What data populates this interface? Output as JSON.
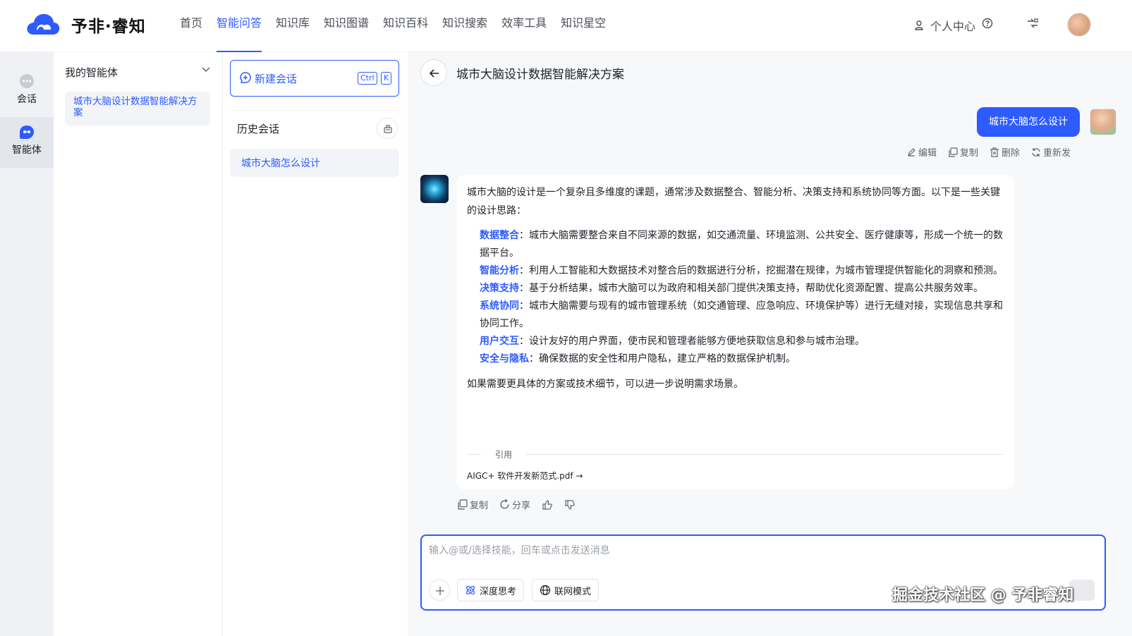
{
  "brand": {
    "name": "予非·睿知",
    "color": "#2e5bff"
  },
  "nav": {
    "items": [
      "首页",
      "智能问答",
      "知识库",
      "知识图谱",
      "知识百科",
      "知识搜索",
      "效率工具",
      "知识星空"
    ],
    "active_index": 1
  },
  "top_right": {
    "personal_center": "个人中心"
  },
  "rail": {
    "chat_label": "会话",
    "agent_label": "智能体"
  },
  "agents": {
    "header": "我的智能体",
    "items": [
      "城市大脑设计数据智能解决方案"
    ]
  },
  "history": {
    "new_chat_label": "新建会话",
    "shortcut_ctrl": "Ctrl",
    "shortcut_key": "K",
    "title": "历史会话",
    "items": [
      "城市大脑怎么设计"
    ]
  },
  "conversation": {
    "title": "城市大脑设计数据智能解决方案",
    "user_message": "城市大脑怎么设计",
    "user_actions": [
      "编辑",
      "复制",
      "删除",
      "重新发"
    ],
    "answer": {
      "intro": "城市大脑的设计是一个复杂且多维度的课题，通常涉及数据整合、智能分析、决策支持和系统协同等方面。以下是一些关键的设计思路：",
      "points": [
        {
          "label": "数据整合",
          "text": "：城市大脑需要整合来自不同来源的数据，如交通流量、环境监测、公共安全、医疗健康等，形成一个统一的数据平台。"
        },
        {
          "label": "智能分析",
          "text": "：利用人工智能和大数据技术对整合后的数据进行分析，挖掘潜在规律，为城市管理提供智能化的洞察和预测。"
        },
        {
          "label": "决策支持",
          "text": "：基于分析结果，城市大脑可以为政府和相关部门提供决策支持，帮助优化资源配置、提高公共服务效率。"
        },
        {
          "label": "系统协同",
          "text": "：城市大脑需要与现有的城市管理系统（如交通管理、应急响应、环境保护等）进行无缝对接，实现信息共享和协同工作。"
        },
        {
          "label": "用户交互",
          "text": "：设计友好的用户界面，使市民和管理者能够方便地获取信息和参与城市治理。"
        },
        {
          "label": "安全与隐私",
          "text": "：确保数据的安全性和用户隐私，建立严格的数据保护机制。"
        }
      ],
      "outro": "如果需要更具体的方案或技术细节，可以进一步说明需求场景。",
      "citation_label": "引用",
      "citation_file": "AIGC+ 软件开发新范式.pdf →"
    },
    "bot_actions": [
      "复制",
      "分享"
    ]
  },
  "input": {
    "placeholder": "输入@或/选择技能，回车或点击发送消息",
    "value": "",
    "deep_think_label": "深度思考",
    "web_mode_label": "联网模式"
  },
  "watermark": "掘金技术社区 @ 予非睿知"
}
